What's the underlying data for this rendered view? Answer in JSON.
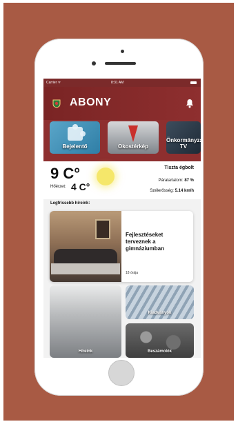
{
  "colors": {
    "backdrop": "#a85a44",
    "header": "#7a2424",
    "accent_sun": "#f5e76a"
  },
  "status_bar": {
    "carrier": "Carrier ᯤ",
    "time": "8:31 AM"
  },
  "header": {
    "title": "ABONY",
    "crest_icon": "crest-icon",
    "bell_icon": "bell-icon"
  },
  "tiles": [
    {
      "label": "Bejelentő"
    },
    {
      "label": "Okostérkép"
    },
    {
      "label": "Önkormányzati TV"
    }
  ],
  "weather": {
    "temp": "9 C°",
    "feels_label": "Hőérzet:",
    "feels_value": "4 C°",
    "description": "Tiszta égbolt",
    "humidity_label": "Páratartalom:",
    "humidity_value": "87 %",
    "wind_label": "Szélerősség:",
    "wind_value": "5.14 km/h"
  },
  "news_section": {
    "title": "Legfrissebb híreink:"
  },
  "featured_news": {
    "title": "Fejlesztéseket terveznek a gimnáziumban",
    "age": "18 órája"
  },
  "grid": [
    {
      "label": "Híreink"
    },
    {
      "label": "Kiadványok"
    },
    {
      "label": "Beszámolók"
    }
  ]
}
